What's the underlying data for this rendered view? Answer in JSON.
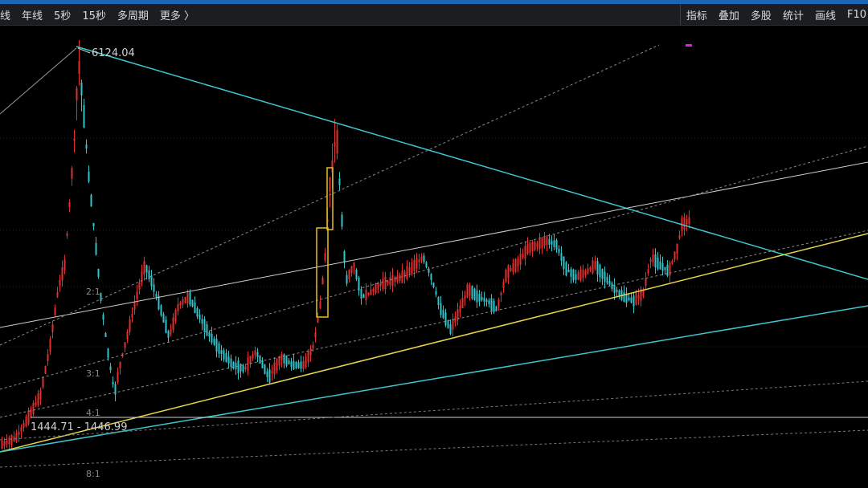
{
  "toolbar": {
    "left_items": [
      "线",
      "年线",
      "5秒",
      "15秒",
      "多周期",
      "更多 〉"
    ],
    "right_items": [
      "指标",
      "叠加",
      "多股",
      "统计",
      "画线",
      "F10"
    ]
  },
  "chart": {
    "price_labels": {
      "high": "6124.04",
      "range": "1444.71 - 1446.99"
    },
    "ratio_labels": [
      "2:1",
      "3:1",
      "4:1",
      "8:1"
    ],
    "colors": {
      "up": "#e03030",
      "down": "#33c4cc",
      "trend_cyan": "#3ec6cc",
      "trend_yellow": "#e8d44a",
      "trend_white": "#cfcfcf",
      "marker": "#e020e0"
    }
  }
}
